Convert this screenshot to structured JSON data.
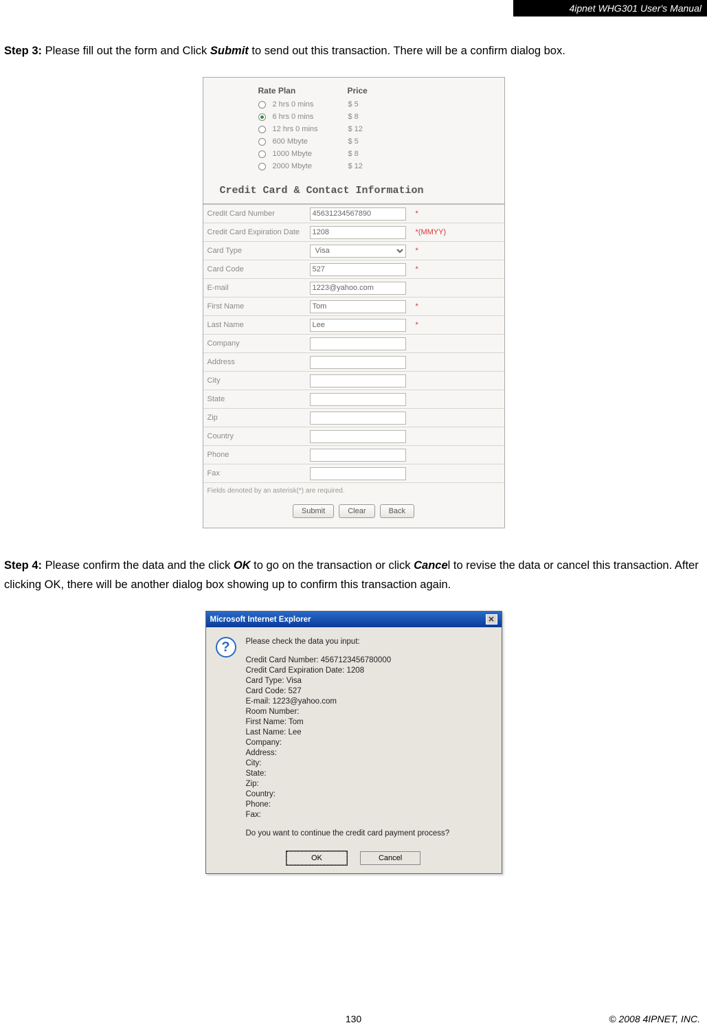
{
  "header": {
    "title": "4ipnet WHG301 User's Manual"
  },
  "step3": {
    "prefix": "Step 3:",
    "body_a": " Please fill out the form and Click ",
    "bold_a": "Submit",
    "body_b": " to send out this transaction. There will be a confirm dialog box."
  },
  "step4": {
    "prefix": "Step 4:",
    "body_a": " Please confirm the data and the click ",
    "bold_a": "OK",
    "body_b": " to go on the transaction or click ",
    "bold_b": "Cance",
    "suffix_b": "l",
    "body_c": " to revise the data or cancel this transaction. After clicking OK, there will be another dialog box showing up to confirm this transaction again."
  },
  "form": {
    "headers": {
      "plan": "Rate Plan",
      "price": "Price"
    },
    "plans": [
      {
        "label": "2 hrs 0 mins",
        "price": "$ 5",
        "selected": false
      },
      {
        "label": "6 hrs 0 mins",
        "price": "$ 8",
        "selected": true
      },
      {
        "label": "12 hrs 0 mins",
        "price": "$ 12",
        "selected": false
      },
      {
        "label": "600 Mbyte",
        "price": "$ 5",
        "selected": false
      },
      {
        "label": "1000 Mbyte",
        "price": "$ 8",
        "selected": false
      },
      {
        "label": "2000 Mbyte",
        "price": "$ 12",
        "selected": false
      }
    ],
    "section_title": "Credit Card & Contact Information",
    "fields": {
      "cc_number": {
        "label": "Credit Card Number",
        "value": "45631234567890",
        "req": "*"
      },
      "cc_exp": {
        "label": "Credit Card Expiration Date",
        "value": "1208",
        "req": "*(MMYY)"
      },
      "card_type": {
        "label": "Card Type",
        "value": "Visa",
        "req": "*"
      },
      "card_code": {
        "label": "Card Code",
        "value": "527",
        "req": "*"
      },
      "email": {
        "label": "E-mail",
        "value": "1223@yahoo.com",
        "req": ""
      },
      "first": {
        "label": "First Name",
        "value": "Tom",
        "req": "*"
      },
      "last": {
        "label": "Last Name",
        "value": "Lee",
        "req": "*"
      },
      "company": {
        "label": "Company",
        "value": "",
        "req": ""
      },
      "address": {
        "label": "Address",
        "value": "",
        "req": ""
      },
      "city": {
        "label": "City",
        "value": "",
        "req": ""
      },
      "state": {
        "label": "State",
        "value": "",
        "req": ""
      },
      "zip": {
        "label": "Zip",
        "value": "",
        "req": ""
      },
      "country": {
        "label": "Country",
        "value": "",
        "req": ""
      },
      "phone": {
        "label": "Phone",
        "value": "",
        "req": ""
      },
      "fax": {
        "label": "Fax",
        "value": "",
        "req": ""
      }
    },
    "note": "Fields denoted by an asterisk(*) are required.",
    "buttons": {
      "submit": "Submit",
      "clear": "Clear",
      "back": "Back"
    }
  },
  "dialog": {
    "title": "Microsoft Internet Explorer",
    "close": "✕",
    "lines": [
      "Please check the data you input:",
      "",
      "Credit Card Number: 4567123456780000",
      "Credit Card Expiration Date: 1208",
      "Card Type: Visa",
      "Card Code: 527",
      "E-mail: 1223@yahoo.com",
      "Room Number:",
      "First Name: Tom",
      "Last Name: Lee",
      "Company:",
      "Address:",
      "City:",
      "State:",
      "Zip:",
      "Country:",
      "Phone:",
      "Fax:",
      "",
      "Do you want to continue the credit card payment process?"
    ],
    "ok": "OK",
    "cancel": "Cancel"
  },
  "footer": {
    "page": "130",
    "copy": "© 2008 4IPNET, INC."
  }
}
